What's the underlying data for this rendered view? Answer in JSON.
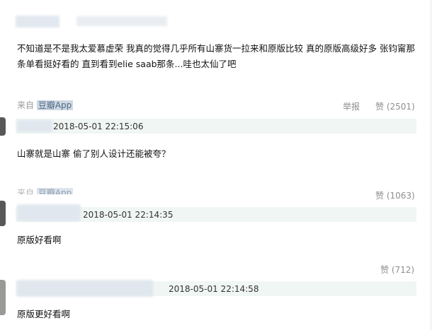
{
  "main_comment": {
    "text": "不知道是不是我太爱慕虚荣 我真的觉得几乎所有山寨货一拉来和原版比较 真的原版高级好多 张钧甯那条单看挺好看的 直到看到elie saab那条...哇也太仙了吧",
    "from_label": "来自",
    "source": "豆瓣App",
    "report_label": "举报",
    "like_label": "赞 (2501)"
  },
  "replies": [
    {
      "time": "2018-05-01 22:15:06",
      "text": "山寨就是山寨 偷了别人设计还能被夸？",
      "from_label": "来自",
      "source": "豆瓣App",
      "like_label": "赞 (1063)"
    },
    {
      "time": "2018-05-01 22:14:35",
      "text": "原版好看啊",
      "like_label": "赞 (712)"
    },
    {
      "time": "2018-05-01 22:14:58",
      "text": "原版更好看啊"
    }
  ]
}
